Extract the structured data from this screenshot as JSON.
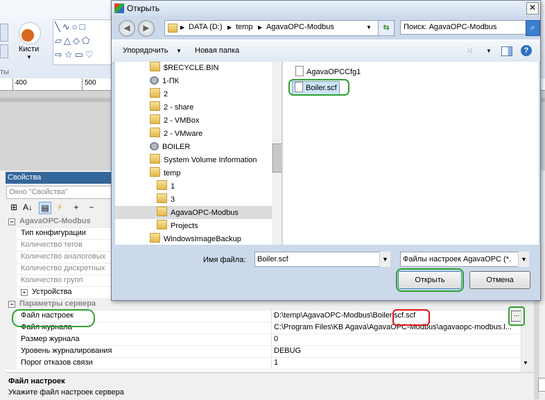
{
  "ribbon": {
    "brushes_label": "Кисти",
    "left_fragment": "ты"
  },
  "ruler": {
    "ticks": [
      "400",
      "500"
    ]
  },
  "properties": {
    "header": "Свойства",
    "search_placeholder": "Окно \"Свойства\"",
    "rows": [
      {
        "key": "AgavaOPC-Modbus",
        "value": ""
      },
      {
        "key": "Тип конфигурации",
        "value": ""
      },
      {
        "key": "Количество тегов",
        "value": ""
      },
      {
        "key": "Количество аналоговых",
        "value": ""
      },
      {
        "key": "Количество дискретных",
        "value": ""
      },
      {
        "key": "Количество групп",
        "value": ""
      },
      {
        "key": "Устройства",
        "value": ""
      },
      {
        "key": "Параметры сервера",
        "value": ""
      },
      {
        "key": "Файл настроек",
        "value": "D:\\temp\\AgavaOPC-Modbus\\Boiler.scf.scf"
      },
      {
        "key": "Файл журнала",
        "value": "C:\\Program Files\\KB Agava\\AgavaOPC-Modbus\\agavaopc-modbus.l..."
      },
      {
        "key": "Размер журнала",
        "value": "0"
      },
      {
        "key": "Уровень журналирования",
        "value": "DEBUG"
      },
      {
        "key": "Порог отказов связи",
        "value": "1"
      }
    ],
    "browse_button": "...",
    "description_title": "Файл настроек",
    "description_text": "Укажите файл настроек сервера"
  },
  "dialog": {
    "title": "Открыть",
    "breadcrumbs": [
      "DATA (D:)",
      "temp",
      "AgavaOPC-Modbus"
    ],
    "search_placeholder": "Поиск: AgavaOPC-Modbus",
    "organize": "Упорядочить",
    "new_folder": "Новая папка",
    "tree": [
      {
        "label": "$RECYCLE.BIN",
        "icon": "folder"
      },
      {
        "label": "1-ПК",
        "icon": "drive"
      },
      {
        "label": "2",
        "icon": "folder"
      },
      {
        "label": "2 - share",
        "icon": "folder"
      },
      {
        "label": "2 - VMBox",
        "icon": "folder"
      },
      {
        "label": "2 - VMware",
        "icon": "folder"
      },
      {
        "label": "BOILER",
        "icon": "drive"
      },
      {
        "label": "System Volume Information",
        "icon": "folder"
      },
      {
        "label": "temp",
        "icon": "folder"
      },
      {
        "label": "1",
        "icon": "folder"
      },
      {
        "label": "3",
        "icon": "folder"
      },
      {
        "label": "AgavaOPC-Modbus",
        "icon": "folder"
      },
      {
        "label": "Projects",
        "icon": "folder"
      },
      {
        "label": "WindowsImageBackup",
        "icon": "folder"
      }
    ],
    "files": [
      "AgavaOPCCfg1",
      "Boiler.scf"
    ],
    "filename_label": "Имя файла:",
    "filename_value": "Boiler.scf",
    "filetype_value": "Файлы настроек AgavaOPC (*.",
    "open_label": "Открыть",
    "cancel_label": "Отмена"
  },
  "colors": {
    "highlight_green": "#2fa12f",
    "highlight_red": "#e01414",
    "panel_header": "#336699"
  }
}
